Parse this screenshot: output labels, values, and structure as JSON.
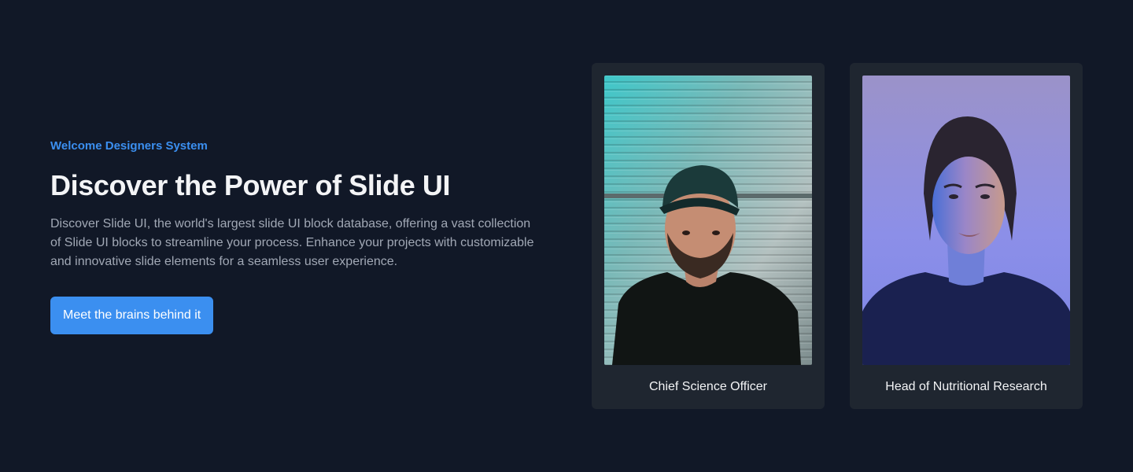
{
  "hero": {
    "eyebrow": "Welcome Designers System",
    "title": "Discover the Power of Slide UI",
    "description": "Discover Slide UI, the world's largest slide UI block database, offering a vast collection of Slide UI blocks to streamline your process. Enhance your projects with customizable and innovative slide elements for a seamless user experience.",
    "cta_label": "Meet the brains behind it"
  },
  "team": [
    {
      "role": "Chief Science Officer",
      "photo": "man-in-cap-portrait"
    },
    {
      "role": "Head of Nutritional Research",
      "photo": "woman-blue-light-portrait"
    }
  ],
  "colors": {
    "background": "#111827",
    "accent": "#3b8ff0",
    "card": "#1f2630"
  }
}
